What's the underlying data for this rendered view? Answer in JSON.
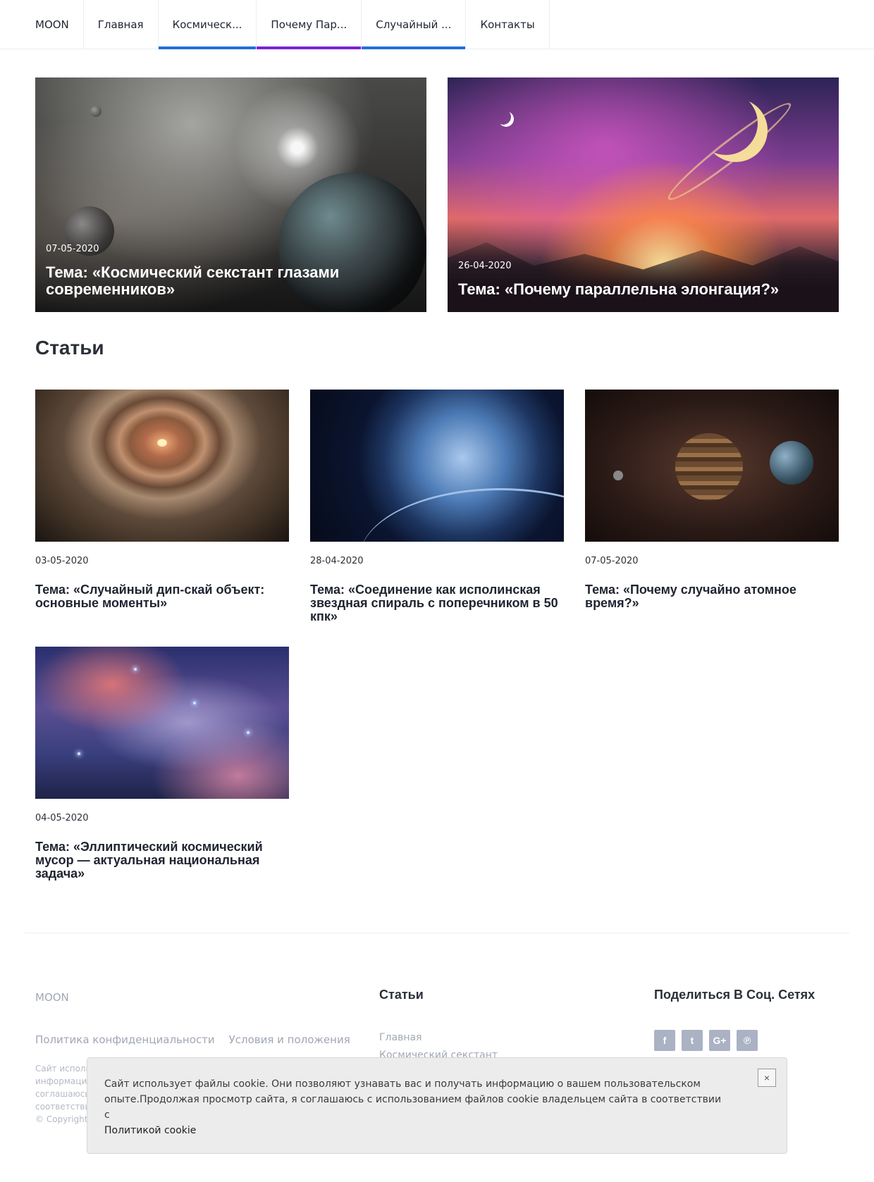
{
  "nav": {
    "brand": "MOON",
    "items": [
      {
        "label": "Главная"
      },
      {
        "label": "Космическ..."
      },
      {
        "label": "Почему Пар..."
      },
      {
        "label": "Случайный ..."
      },
      {
        "label": "Контакты"
      }
    ],
    "accent_blue": "#1f6fd8",
    "accent_purple": "#7b22d6"
  },
  "hero": [
    {
      "date": "07-05-2020",
      "title": "Тема: «Космический секстант глазами современников»"
    },
    {
      "date": "26-04-2020",
      "title": "Тема: «Почему параллельна элонгация?»"
    }
  ],
  "section_title": "Статьи",
  "cards": [
    {
      "date": "03-05-2020",
      "title": "Тема: «Случайный дип-скай объект: основные моменты»"
    },
    {
      "date": "28-04-2020",
      "title": "Тема: «Соединение как исполинская звездная спираль с поперечником в 50 кпк»"
    },
    {
      "date": "07-05-2020",
      "title": "Тема: «Почему случайно атомное время?»"
    },
    {
      "date": "04-05-2020",
      "title": "Тема: «Эллиптический космический мусор — актуальная национальная задача»"
    }
  ],
  "footer": {
    "brand": "MOON",
    "privacy": "Политика конфиденциальности",
    "terms": "Условия и положения",
    "small_lines": [
      "Сайт использ",
      "информацию",
      "соглашаюсь",
      "соответстви",
      "© Copyright"
    ],
    "articles_title": "Статьи",
    "article_links": [
      "Главная",
      "Космический секстант"
    ],
    "share_title": "Поделиться В Соц. Сетях",
    "social": [
      {
        "icon": "facebook-icon",
        "glyph": "f"
      },
      {
        "icon": "twitter-icon",
        "glyph": "t"
      },
      {
        "icon": "google-plus-icon",
        "glyph": "G+"
      },
      {
        "icon": "pinterest-icon",
        "glyph": "℗"
      }
    ]
  },
  "cookie": {
    "text": "Сайт использует файлы cookie. Они позволяют узнавать вас и получать информацию о вашем пользовательском опыте.Продолжая просмотр сайта, я соглашаюсь с использованием файлов cookie владельцем сайта в соответствии с",
    "link": "Политикой cookie",
    "close": "×"
  }
}
